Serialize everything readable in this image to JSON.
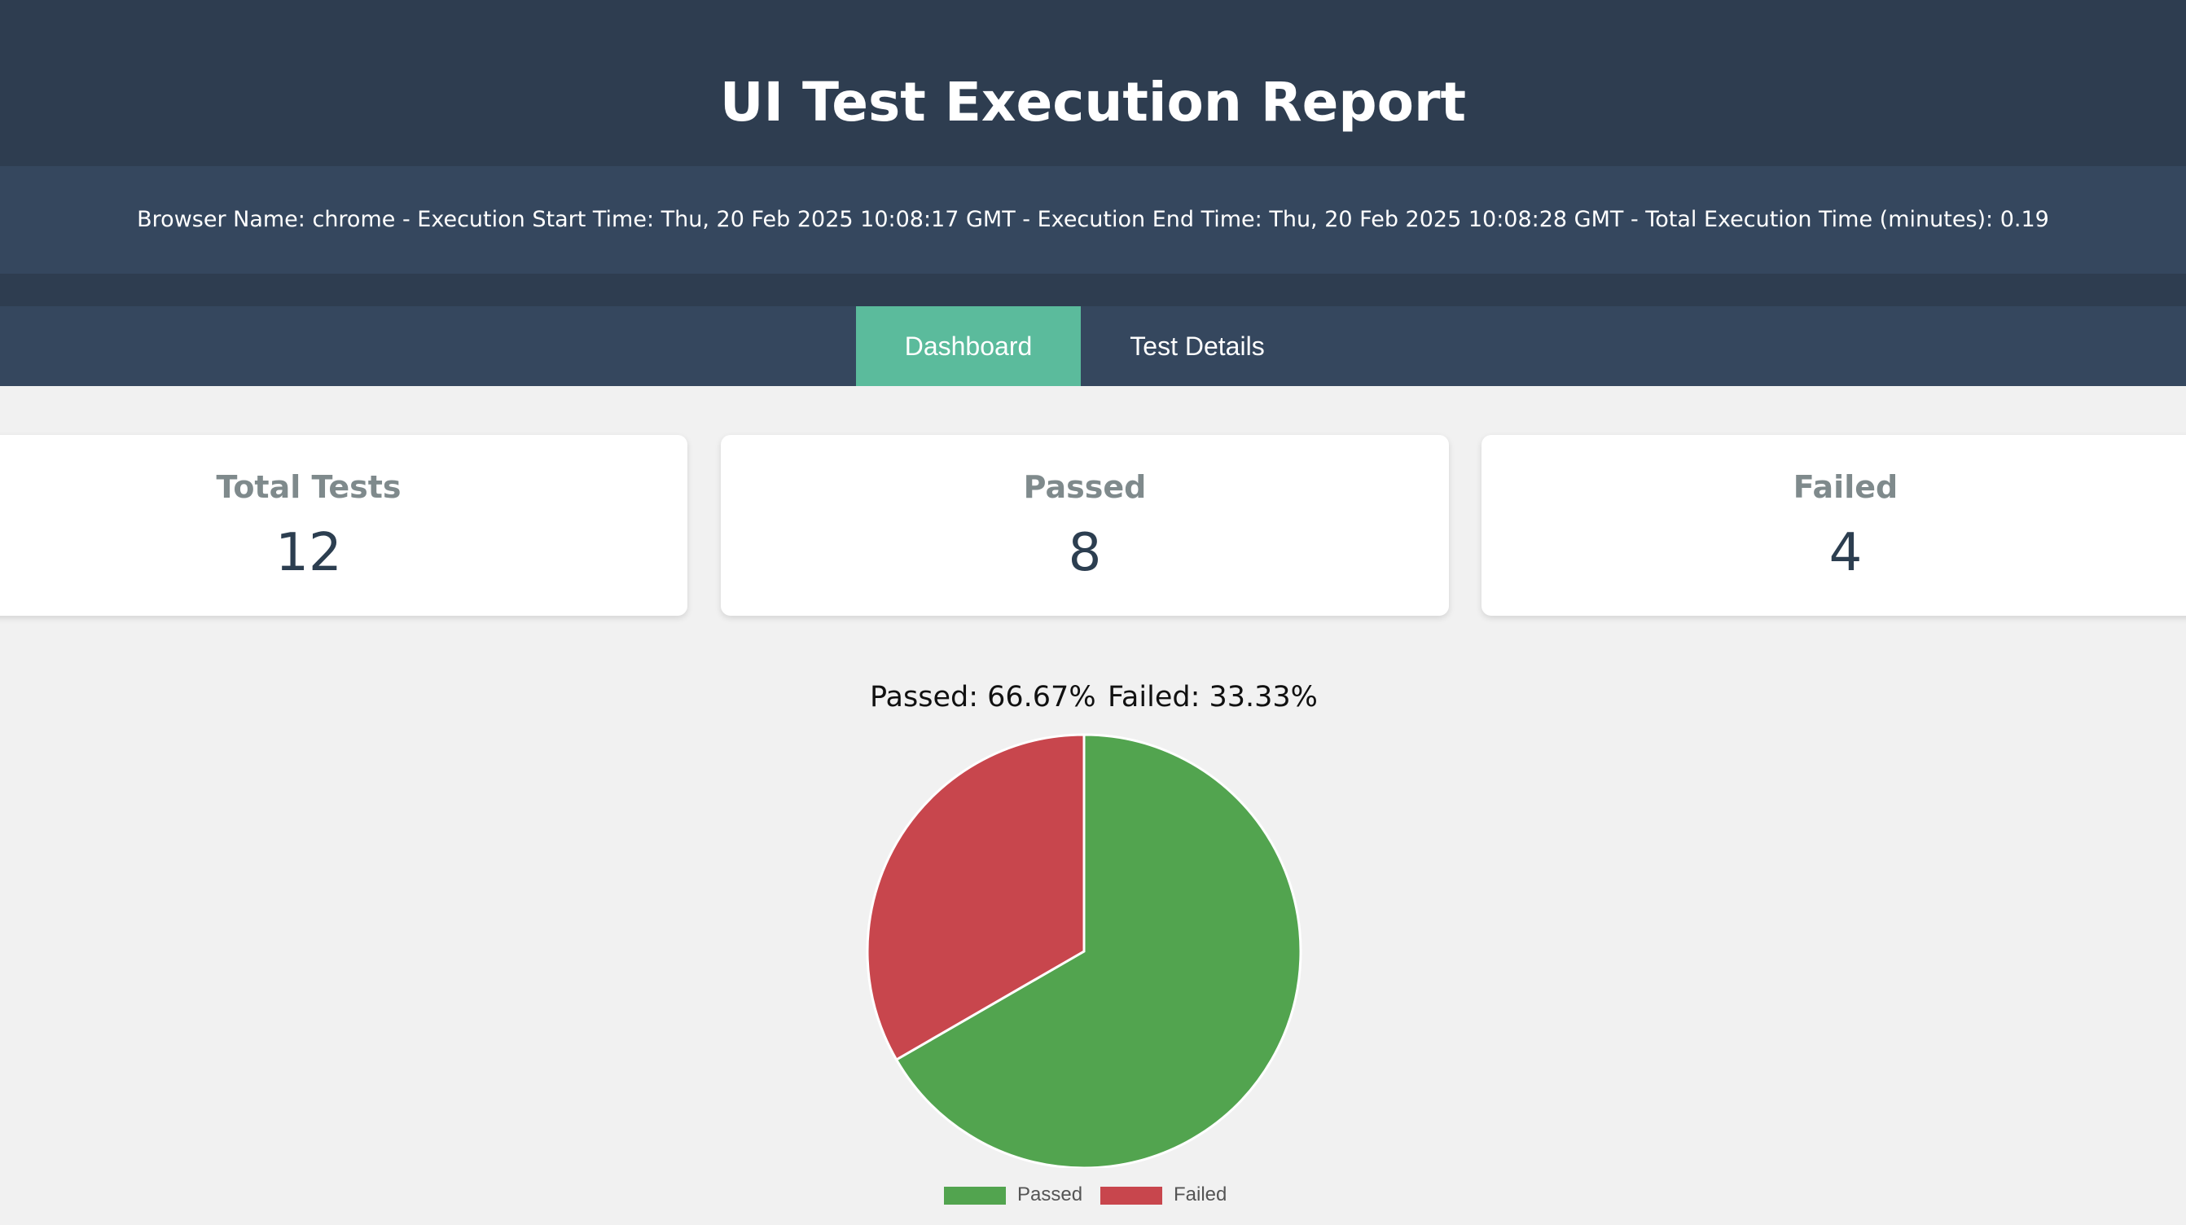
{
  "header": {
    "title": "UI Test Execution Report",
    "info": "Browser Name: chrome - Execution Start Time: Thu, 20 Feb 2025 10:08:17 GMT - Execution End Time: Thu, 20 Feb 2025 10:08:28 GMT - Total Execution Time (minutes): 0.19"
  },
  "nav": {
    "tabs": [
      {
        "label": "Dashboard",
        "active": true
      },
      {
        "label": "Test Details",
        "active": false
      }
    ]
  },
  "summary": {
    "cards": [
      {
        "label": "Total Tests",
        "value": "12"
      },
      {
        "label": "Passed",
        "value": "8"
      },
      {
        "label": "Failed",
        "value": "4"
      }
    ]
  },
  "chart_data": {
    "type": "pie",
    "slices": [
      {
        "name": "Passed",
        "value": 8,
        "percent_label": "Passed: 66.67%",
        "color": "#52a44f"
      },
      {
        "name": "Failed",
        "value": 4,
        "percent_label": "Failed: 33.33%",
        "color": "#c8464d"
      }
    ],
    "legend": [
      "Passed",
      "Failed"
    ],
    "legend_position": "bottom"
  },
  "colors": {
    "header_bg": "#2e3d50",
    "band_bg": "#35475e",
    "active_tab": "#5bbb9c",
    "page_bg": "#f1f1f1"
  }
}
